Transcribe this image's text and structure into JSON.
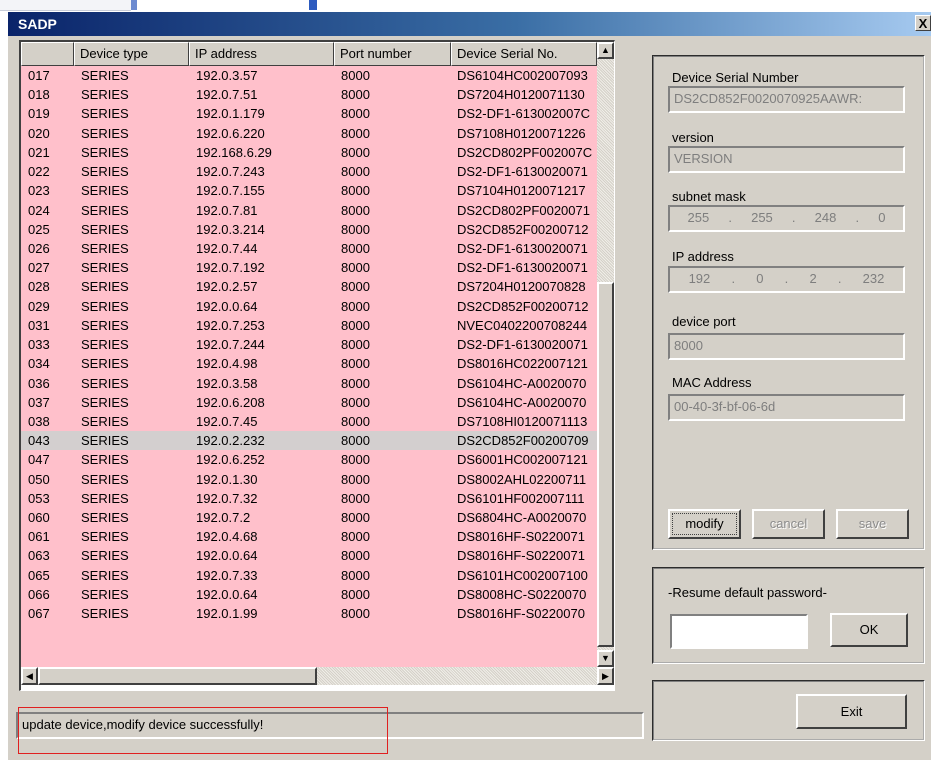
{
  "window": {
    "title": "SADP",
    "close_glyph": "X"
  },
  "table": {
    "columns": [
      "",
      "Device type",
      "IP address",
      "Port number",
      "Device Serial No."
    ],
    "rows": [
      [
        "017",
        "SERIES",
        "192.0.3.57",
        "8000",
        "DS6104HC002007093"
      ],
      [
        "018",
        "SERIES",
        "192.0.7.51",
        "8000",
        "DS7204H0120071130"
      ],
      [
        "019",
        "SERIES",
        "192.0.1.179",
        "8000",
        "DS2-DF1-613002007C"
      ],
      [
        "020",
        "SERIES",
        "192.0.6.220",
        "8000",
        "DS7108H0120071226"
      ],
      [
        "021",
        "SERIES",
        "192.168.6.29",
        "8000",
        "DS2CD802PF002007C"
      ],
      [
        "022",
        "SERIES",
        "192.0.7.243",
        "8000",
        "DS2-DF1-6130020071"
      ],
      [
        "023",
        "SERIES",
        "192.0.7.155",
        "8000",
        "DS7104H0120071217"
      ],
      [
        "024",
        "SERIES",
        "192.0.7.81",
        "8000",
        "DS2CD802PF0020071"
      ],
      [
        "025",
        "SERIES",
        "192.0.3.214",
        "8000",
        "DS2CD852F00200712"
      ],
      [
        "026",
        "SERIES",
        "192.0.7.44",
        "8000",
        "DS2-DF1-6130020071"
      ],
      [
        "027",
        "SERIES",
        "192.0.7.192",
        "8000",
        "DS2-DF1-6130020071"
      ],
      [
        "028",
        "SERIES",
        "192.0.2.57",
        "8000",
        "DS7204H0120070828"
      ],
      [
        "029",
        "SERIES",
        "192.0.0.64",
        "8000",
        "DS2CD852F00200712"
      ],
      [
        "031",
        "SERIES",
        "192.0.7.253",
        "8000",
        "NVEC0402200708244"
      ],
      [
        "033",
        "SERIES",
        "192.0.7.244",
        "8000",
        "DS2-DF1-6130020071"
      ],
      [
        "034",
        "SERIES",
        "192.0.4.98",
        "8000",
        "DS8016HC022007121"
      ],
      [
        "036",
        "SERIES",
        "192.0.3.58",
        "8000",
        "DS6104HC-A0020070"
      ],
      [
        "037",
        "SERIES",
        "192.0.6.208",
        "8000",
        "DS6104HC-A0020070"
      ],
      [
        "038",
        "SERIES",
        "192.0.7.45",
        "8000",
        "DS7108HI0120071113"
      ],
      [
        "043",
        "SERIES",
        "192.0.2.232",
        "8000",
        "DS2CD852F00200709"
      ],
      [
        "047",
        "SERIES",
        "192.0.6.252",
        "8000",
        "DS6001HC002007121"
      ],
      [
        "050",
        "SERIES",
        "192.0.1.30",
        "8000",
        "DS8002AHL02200711"
      ],
      [
        "053",
        "SERIES",
        "192.0.7.32",
        "8000",
        "DS6101HF002007111"
      ],
      [
        "060",
        "SERIES",
        "192.0.7.2",
        "8000",
        "DS6804HC-A0020070"
      ],
      [
        "061",
        "SERIES",
        "192.0.4.68",
        "8000",
        "DS8016HF-S0220071"
      ],
      [
        "063",
        "SERIES",
        "192.0.0.64",
        "8000",
        "DS8016HF-S0220071"
      ],
      [
        "065",
        "SERIES",
        "192.0.7.33",
        "8000",
        "DS6101HC002007100"
      ],
      [
        "066",
        "SERIES",
        "192.0.0.64",
        "8000",
        "DS8008HC-S0220070"
      ],
      [
        "067",
        "SERIES",
        "192.0.1.99",
        "8000",
        "DS8016HF-S0220070"
      ]
    ],
    "selected_row": "043",
    "colors": {
      "row_bg": "#ffc0cb",
      "selected_bg": "#d3cfcf"
    }
  },
  "scrollbar_icons": {
    "up": "▲",
    "down": "▼",
    "left": "◀",
    "right": "▶"
  },
  "status_text": "update device,modify device successfully!",
  "details": {
    "serial_label": "Device Serial Number",
    "serial_value": "DS2CD852F0020070925AAWR:",
    "version_label": "version",
    "version_value": "VERSION",
    "subnet_label": "subnet mask",
    "subnet_octets": [
      "255",
      ".",
      "255",
      ".",
      "248",
      ".",
      "0"
    ],
    "ip_label": "IP address",
    "ip_octets": [
      "192",
      ".",
      "0",
      ".",
      "2",
      ".",
      "232"
    ],
    "port_label": "device port",
    "port_value": "8000",
    "mac_label": "MAC Address",
    "mac_value": "00-40-3f-bf-06-6d",
    "modify_label": "modify",
    "cancel_label": "cancel",
    "save_label": "save"
  },
  "password": {
    "group_label": "-Resume default password-",
    "ok_label": "OK"
  },
  "exit_label": "Exit"
}
